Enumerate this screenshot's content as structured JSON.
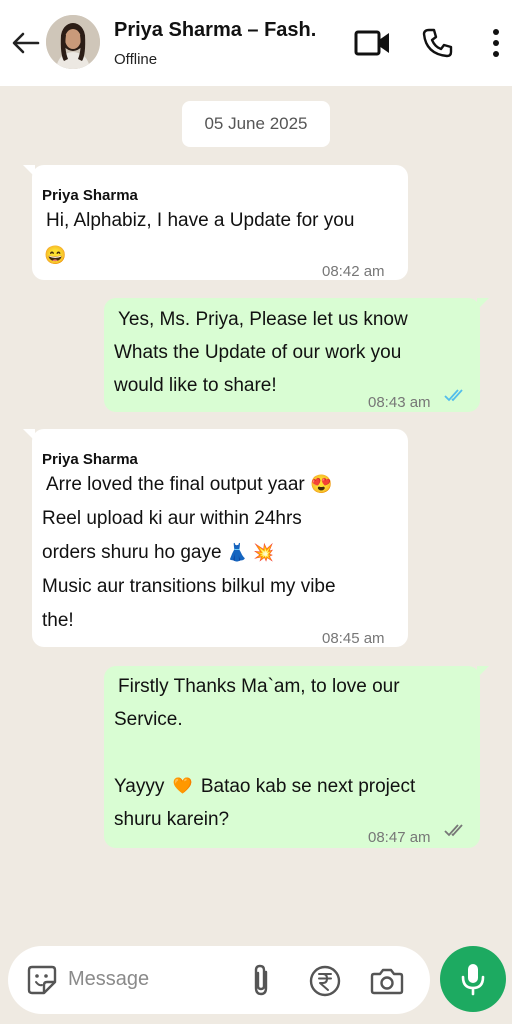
{
  "header": {
    "contact_name": "Priya Sharma – Fash.",
    "status": "Offline",
    "icons": [
      "back-arrow-icon",
      "video-call-icon",
      "voice-call-icon",
      "more-menu-icon"
    ]
  },
  "chat": {
    "date_chip": "05 June 2025",
    "messages": [
      {
        "direction": "in",
        "sender": "Priya Sharma",
        "lines": [
          "Hi, Alphabiz, I have a Update for you",
          ""
        ],
        "emoji": "😄",
        "time": "08:42 am"
      },
      {
        "direction": "out",
        "lines": [
          "Yes, Ms. Priya, Please let us know",
          "Whats the Update of our work you",
          "would like to share!"
        ],
        "time": "08:43 am",
        "read_status": "read"
      },
      {
        "direction": "in",
        "sender": "Priya Sharma",
        "lines": [
          "Arre loved the final output yaar",
          "Reel upload ki aur within 24hrs",
          "orders shuru ho gaye",
          "Music aur transitions bilkul my vibe",
          "the!"
        ],
        "emojis": [
          "😍",
          "👗",
          "💥"
        ],
        "time": "08:45 am"
      },
      {
        "direction": "out",
        "lines": [
          "Firstly Thanks Ma`am, to love our",
          "Service.",
          "",
          "Yayyy",
          "Batao kab se next project",
          "shuru karein?"
        ],
        "emoji": "🧡",
        "time": "08:47 am",
        "read_status": "delivered"
      }
    ]
  },
  "input": {
    "placeholder": "Message",
    "icons": [
      "sticker-icon",
      "attach-icon",
      "rupee-icon",
      "camera-icon",
      "mic-icon"
    ]
  },
  "colors": {
    "chat_background": "#efeae2",
    "outgoing_bubble": "#d9fdd3",
    "incoming_bubble": "#ffffff",
    "mic_button": "#1daa61",
    "read_ticks": "#53bdeb"
  }
}
